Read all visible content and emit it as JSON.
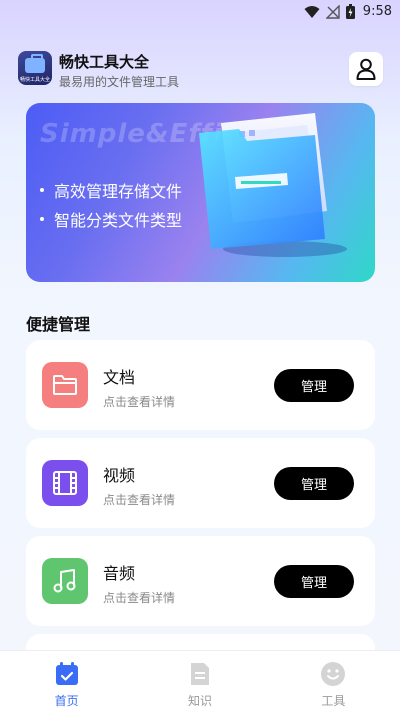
{
  "status_bar": {
    "time": "9:58"
  },
  "header": {
    "logo_caption": "畅快工具大全",
    "title": "畅快工具大全",
    "subtitle": "最易用的文件管理工具"
  },
  "banner": {
    "watermark": "Simple&Effi",
    "features": [
      "高效管理存储文件",
      "智能分类文件类型"
    ]
  },
  "section": {
    "title": "便捷管理"
  },
  "cards": [
    {
      "title": "文档",
      "desc": "点击查看详情",
      "button": "管理",
      "icon": "folder-icon",
      "color": "#f57f7f"
    },
    {
      "title": "视频",
      "desc": "点击查看详情",
      "button": "管理",
      "icon": "film-icon",
      "color": "#7b4fee"
    },
    {
      "title": "音频",
      "desc": "点击查看详情",
      "button": "管理",
      "icon": "music-note-icon",
      "color": "#5fc66f"
    }
  ],
  "bottom_nav": [
    {
      "label": "首页",
      "icon": "calendar-check-icon",
      "active": true
    },
    {
      "label": "知识",
      "icon": "document-icon",
      "active": false
    },
    {
      "label": "工具",
      "icon": "smile-icon",
      "active": false
    }
  ],
  "colors": {
    "active": "#3a6cf5",
    "inactive": "#9a9a9a"
  }
}
